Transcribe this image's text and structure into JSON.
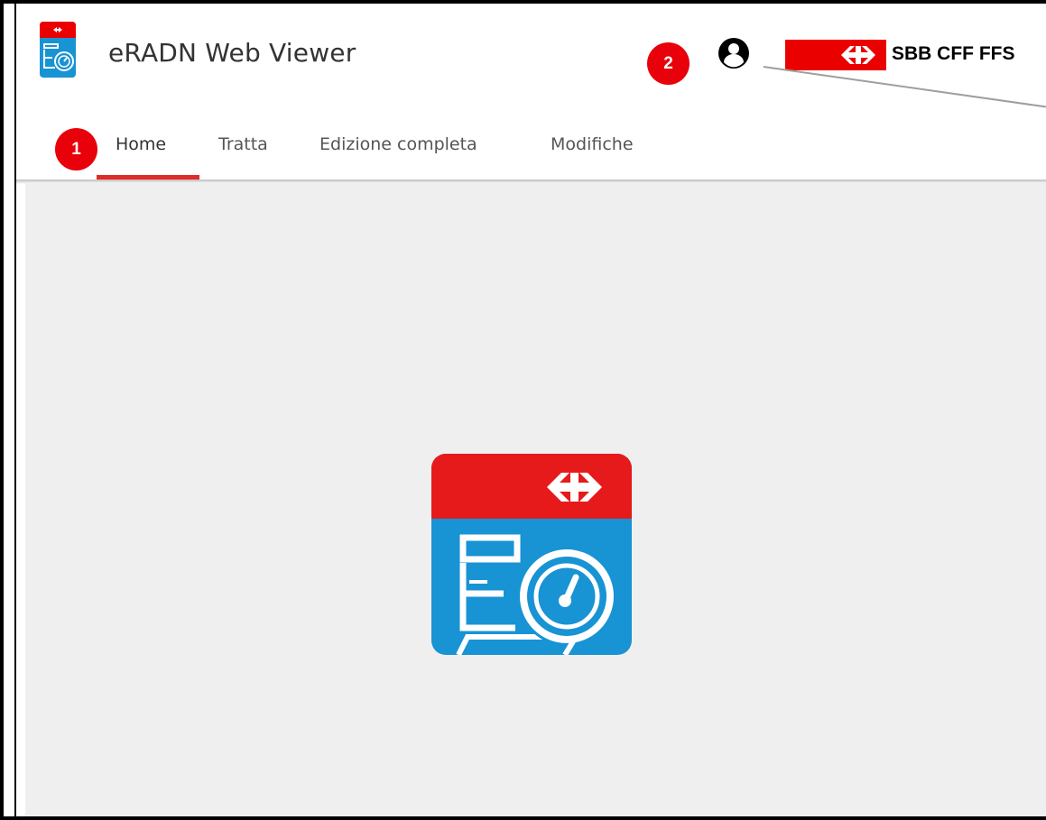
{
  "header": {
    "app_title": "eRADN Web Viewer",
    "brand_text": "SBB CFF FFS"
  },
  "tabs": [
    {
      "label": "Home",
      "active": true
    },
    {
      "label": "Tratta",
      "active": false
    },
    {
      "label": "Edizione completa",
      "active": false
    },
    {
      "label": "Modifiche",
      "active": false
    }
  ],
  "callouts": {
    "nav_marker": "1",
    "user_marker": "2"
  },
  "icons": {
    "app_logo": "eradn-app-icon",
    "user": "user-account-icon",
    "brand": "sbb-logo"
  },
  "colors": {
    "brand_red": "#eb0000",
    "app_blue": "#1893d4",
    "tab_underline": "#e02a2a",
    "content_bg": "#efefef",
    "callout_red": "#e8000a"
  }
}
